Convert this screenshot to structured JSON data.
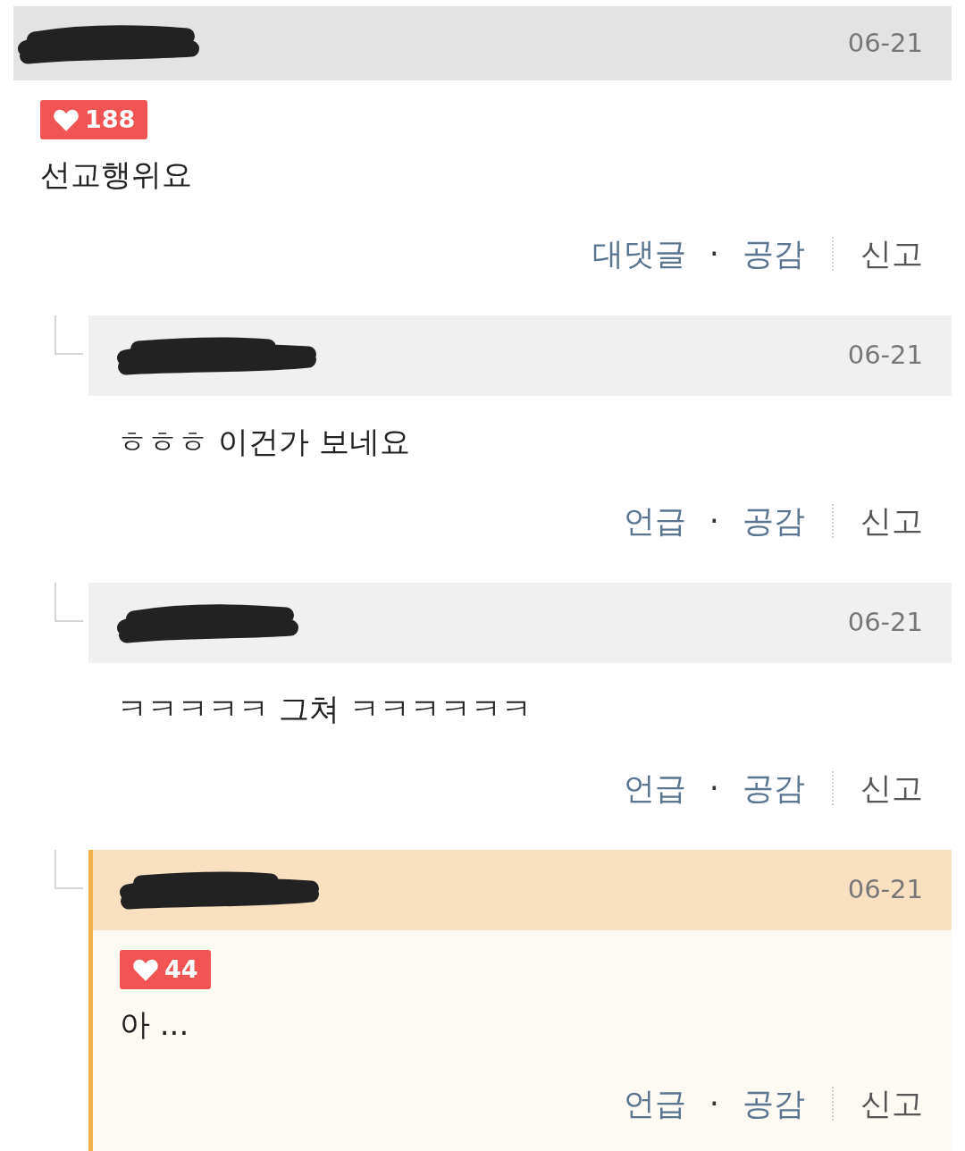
{
  "comments": [
    {
      "kind": "top",
      "highlighted": false,
      "date": "06-21",
      "likes": "188",
      "text": "선교행위요",
      "reply_action": "대댓글",
      "separator": "·",
      "like_action": "공감",
      "report_action": "신고"
    },
    {
      "kind": "reply",
      "highlighted": false,
      "date": "06-21",
      "text": "ㅎㅎㅎ 이건가 보네요",
      "reply_action": "언급",
      "separator": "·",
      "like_action": "공감",
      "report_action": "신고"
    },
    {
      "kind": "reply",
      "highlighted": false,
      "date": "06-21",
      "text": "ㅋㅋㅋㅋㅋ 그쳐 ㅋㅋㅋㅋㅋㅋ",
      "reply_action": "언급",
      "separator": "·",
      "like_action": "공감",
      "report_action": "신고"
    },
    {
      "kind": "reply",
      "highlighted": true,
      "date": "06-21",
      "likes": "44",
      "text": "아 ...",
      "reply_action": "언급",
      "separator": "·",
      "like_action": "공감",
      "report_action": "신고"
    }
  ]
}
